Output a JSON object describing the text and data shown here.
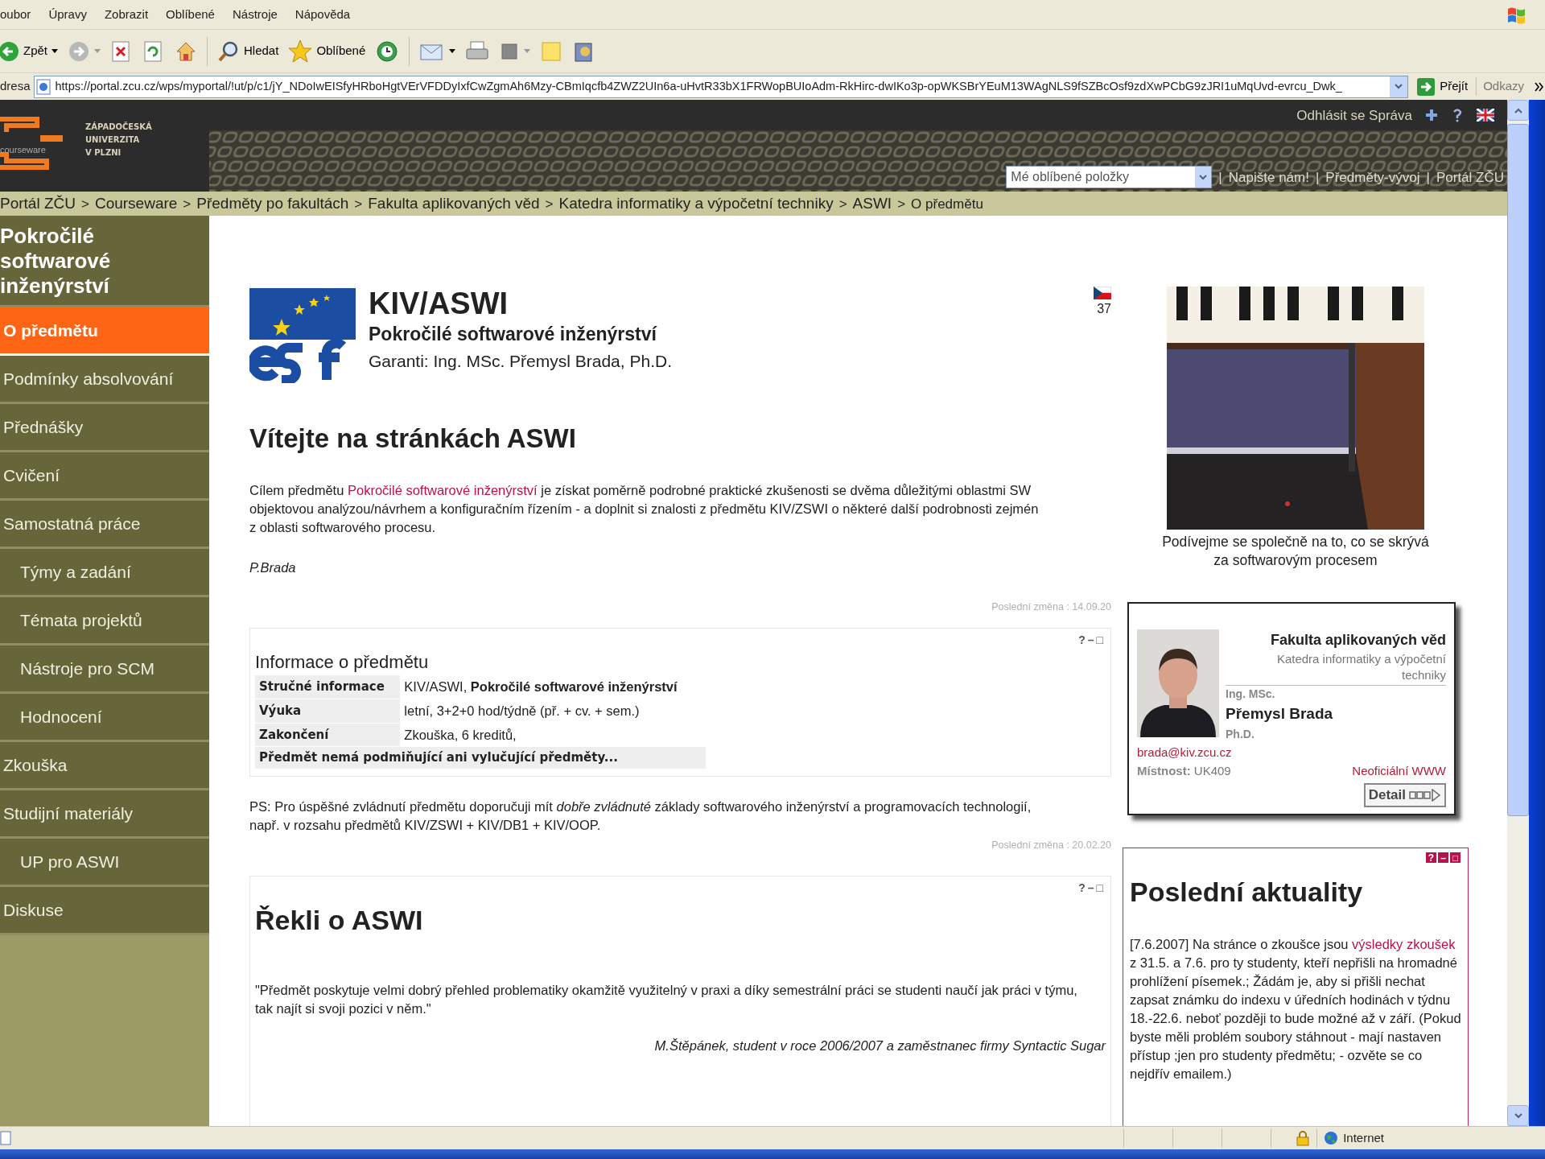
{
  "menu_bar": [
    "oubor",
    "Úpravy",
    "Zobrazit",
    "Oblíbené",
    "Nástroje",
    "Nápověda"
  ],
  "toolbar": {
    "back": "Zpět",
    "search": "Hledat",
    "favorites": "Oblíbené"
  },
  "address_bar": {
    "label": "dresa",
    "url": "https://portal.zcu.cz/wps/myportal/!ut/p/c1/jY_NDoIwEISfyHRboHgtVErVFDDyIxfCwZgmAh6Mzy-CBmIqcfb4ZWZ2UIn6a-uHvtR33bX1FRWopBUIoAdm-RkHirc-dwIKo3p-opWKSBrYEuM13WAgNLS9fSZBcOsf9zdXwPCbG9zJRI1uMqUvd-evrcu_Dwk_",
    "go": "Přejít",
    "links": "Odkazy"
  },
  "header": {
    "logo_text": "courseware",
    "university": [
      "ZÁPADOČESKÁ",
      "UNIVERZITA",
      "V PLZNI"
    ],
    "user_links": "Odhlásit se Správa",
    "favorites_select": "Mé oblíbené položky",
    "separator": "|",
    "nav_links": [
      "Napište nám!",
      "Předměty-vývoj",
      "Portál ZČU"
    ]
  },
  "breadcrumb": {
    "separator": ">",
    "items": [
      {
        "label": "Portál ZČU",
        "link": true
      },
      {
        "label": "Courseware",
        "link": true
      },
      {
        "label": "Předměty po fakultách",
        "link": true
      },
      {
        "label": "Fakulta aplikovaných věd",
        "link": true
      },
      {
        "label": "Katedra informatiky a výpočetní techniky",
        "link": true
      },
      {
        "label": "ASWI",
        "link": true
      },
      {
        "label": "O předmětu",
        "link": false
      }
    ]
  },
  "sidebar": {
    "title": "Pokročilé softwarové inženýrství",
    "items": [
      {
        "label": "O předmětu",
        "selected": true
      },
      {
        "label": "Podmínky absolvování",
        "selected": false
      },
      {
        "label": "Přednášky",
        "selected": false
      },
      {
        "label": "Cvičení",
        "selected": false
      },
      {
        "label": "Samostatná práce",
        "selected": false,
        "children": [
          {
            "label": "Týmy a zadání",
            "selected": false
          },
          {
            "label": "Témata projektů",
            "selected": false
          },
          {
            "label": "Nástroje pro SCM",
            "selected": false
          },
          {
            "label": "Hodnocení",
            "selected": false
          }
        ]
      },
      {
        "label": "Zkouška",
        "selected": false
      },
      {
        "label": "Studijní materiály",
        "selected": false,
        "children": [
          {
            "label": "UP pro ASWI",
            "selected": false
          }
        ]
      },
      {
        "label": "Diskuse",
        "selected": false
      }
    ]
  },
  "course": {
    "code": "KIV/ASWI",
    "name": "Pokročilé softwarové inženýrství",
    "guarantors": "Garanti: Ing. MSc. Přemysl Brada, Ph.D.",
    "counter": "37"
  },
  "welcome": {
    "heading": "Vítejte na stránkách ASWI",
    "before": "Cílem předmětu ",
    "link": "Pokročilé softwarové inženýrství",
    "after": " je získat poměrně podrobné praktické zkušenosti se dvěma důležitými oblastmi SW\nobjektovou analýzou/návrhem a konfiguračním řízením - a doplnit si znalosti z předmětu KIV/ZSWI o některé další podrobnosti zejmén\nz oblasti softwarového procesu.",
    "signature": "P.Brada",
    "last_change": "Poslední změna : 14.09.20"
  },
  "info_portlet": {
    "controls": [
      "?",
      "–",
      "□"
    ],
    "title": "Informace o předmětu",
    "rows": [
      {
        "label": "Stručné informace",
        "value": "KIV/ASWI, **Pokročilé softwarové inženýrství**"
      },
      {
        "label": "Výuka",
        "value": "letní, 3+2+0 hod/týdně (př. + cv. + sem.)"
      },
      {
        "label": "Zakončení",
        "value": "Zkouška, 6 kreditů,"
      }
    ],
    "note": "Předmět nemá podmiňující ani vylučující předměty..."
  },
  "ps": {
    "text": "PS: Pro úspěšné zvládnutí předmětu doporučuji mít *dobře zvládnuté* základy softwarového inženýrství a programovacích technologií,\nnapř. v rozsahu předmětů KIV/ZSWI + KIV/DB1 + KIV/OOP.",
    "last_change": "Poslední změna : 20.02.20"
  },
  "quotes_portlet": {
    "controls": [
      "?",
      "–",
      "□"
    ],
    "title": "Řekli o ASWI",
    "quote": "\"Předmět poskytuje velmi dobrý přehled problematiky okamžitě využitelný v praxi a díky semestrální práci se studenti naučí jak práci v týmu, tak najít si svoji pozici v něm.\"",
    "author": "M.Štěpánek, student v roce 2006/2007 a zaměstnanec firmy Syntactic Sugar"
  },
  "photo": {
    "kind": "picture",
    "caption": "Podívejme se společně na to, co se skrývá za softwarovým procesem"
  },
  "person_card": {
    "faculty": "Fakulta aplikovaných věd",
    "department": "Katedra informatiky a výpočetní techniky",
    "title_before": "Ing. MSc.",
    "name": "Přemysl Brada",
    "title_after": "Ph.D.",
    "email": "brada@kiv.zcu.cz",
    "room_label": "Místnost:",
    "room": "UK409",
    "web": "Neoficiální WWW",
    "detail": "Detail"
  },
  "news": {
    "controls": [
      "?",
      "–",
      "□"
    ],
    "title": "Poslední aktuality",
    "before": "[7.6.2007] Na stránce o zkoušce jsou ",
    "link": "výsledky zkoušek",
    "after": " z 31.5. a 7.6. pro ty studenty, kteří nepřišli na hromadné prohlížení písemek.; Žádám je, aby si přišli nechat zapsat známku do indexu v úředních hodinách v týdnu 18.-22.6. neboť později to bude možné až v září. (Pokud byste měli problém soubory stáhnout - mají nastaven přístup ;jen pro studenty předmětu; - ozvěte se co nejdřív emailem.)"
  },
  "status_bar": {
    "zone": "Internet"
  }
}
